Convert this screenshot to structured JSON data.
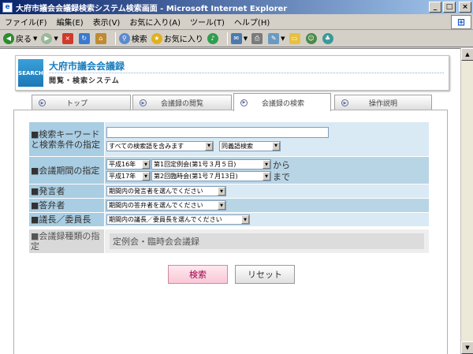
{
  "window": {
    "title": "大府市議会会議録検索システム検索画面 - Microsoft Internet Explorer",
    "minimize": "_",
    "maximize": "□",
    "close": "×"
  },
  "menu": [
    "ファイル(F)",
    "編集(E)",
    "表示(V)",
    "お気に入り(A)",
    "ツール(T)",
    "ヘルプ(H)"
  ],
  "toolbar": {
    "back_label": "戻る",
    "search_label": "検索",
    "favorites_label": "お気に入り"
  },
  "header": {
    "logo_text": "SEARCH",
    "title": "大府市議会会議録",
    "subtitle": "閲覧・検索システム"
  },
  "tabs": [
    {
      "label": "トップ"
    },
    {
      "label": "会議録の閲覧"
    },
    {
      "label": "会議録の検索"
    },
    {
      "label": "操作説明"
    }
  ],
  "form": {
    "keyword": {
      "label": "■検索キーワードと検索条件の指定",
      "value": "",
      "mode": "すべての検索語を含みます",
      "synonym": "同義語検索"
    },
    "period": {
      "label": "■会議期間の指定",
      "from_year": "平成16年",
      "from_session": "第1回定例会(第1号３月５日)",
      "from_suffix": "から",
      "to_year": "平成17年",
      "to_session": "第2回臨時会(第1号７月13日)",
      "to_suffix": "まで"
    },
    "speaker": {
      "label": "■発言者",
      "value": "期間内の発言者を選んでください"
    },
    "respondent": {
      "label": "■答弁者",
      "value": "期間内の答弁者を選んでください"
    },
    "chair": {
      "label": "■議長／委員長",
      "value": "期間内の議長／委員長を選んでください"
    },
    "kind": {
      "label": "■会議録種類の指定",
      "value": "定例会・臨時会会議録"
    }
  },
  "buttons": {
    "search": "検索",
    "reset": "リセット"
  }
}
